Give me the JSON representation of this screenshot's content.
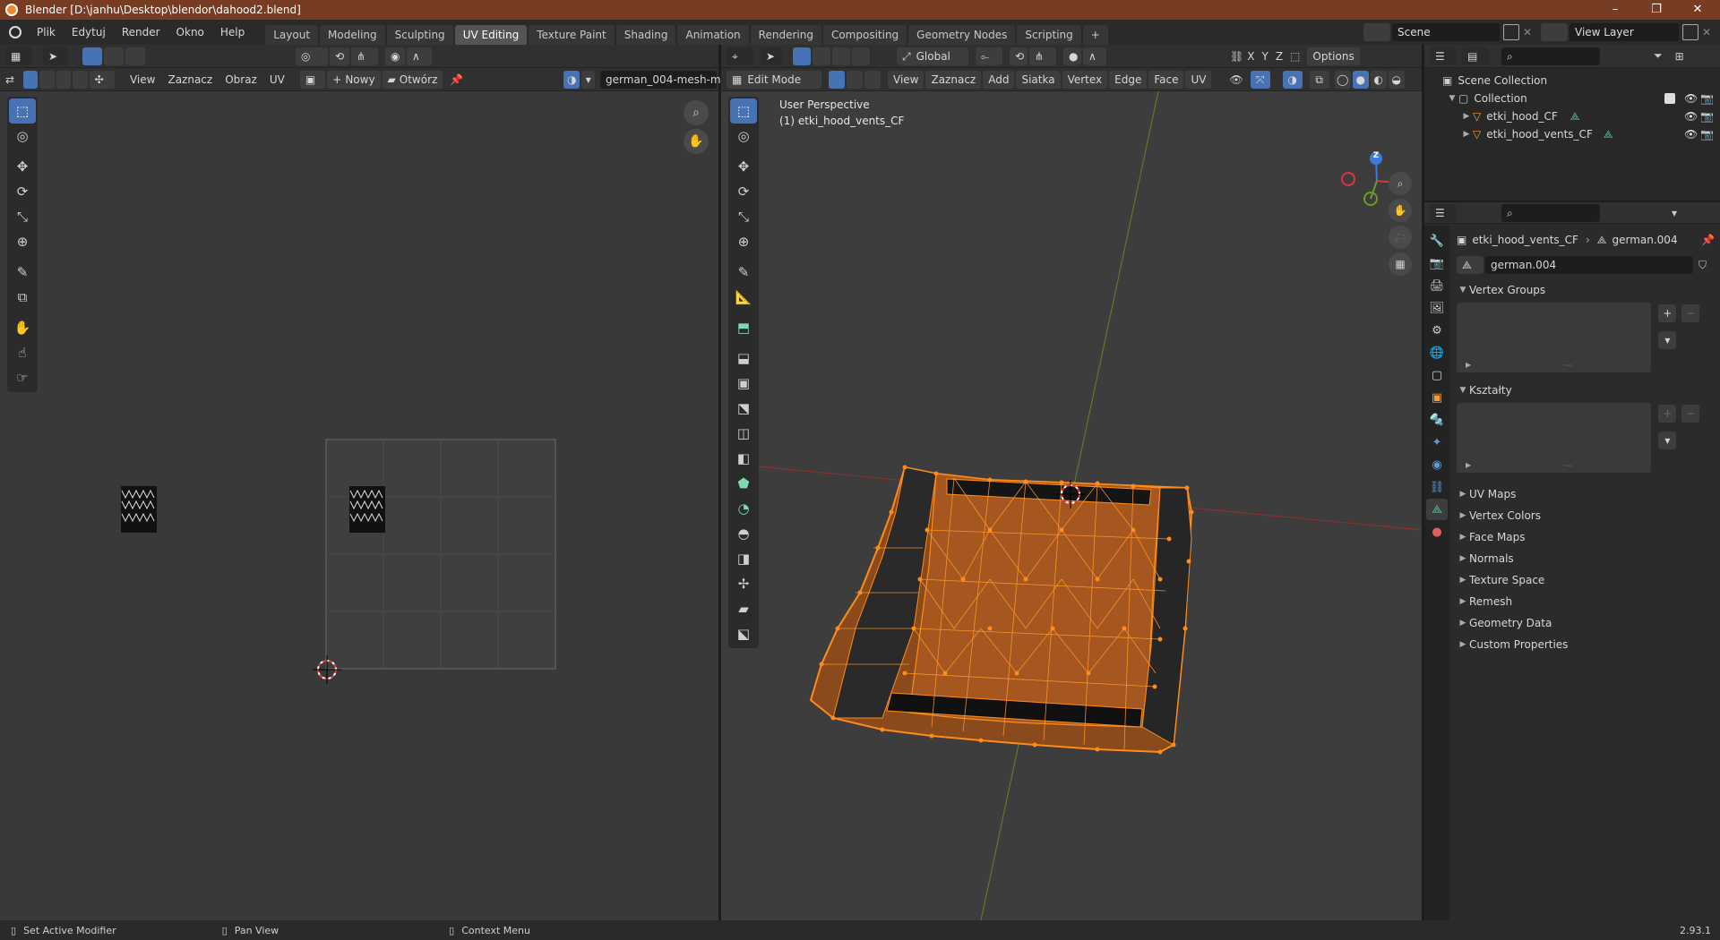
{
  "window": {
    "title": "Blender [D:\\janhu\\Desktop\\blendor\\dahood2.blend]",
    "minimize": "–",
    "restore": "❐",
    "close": "✕"
  },
  "menu": [
    "Plik",
    "Edytuj",
    "Render",
    "Okno",
    "Help"
  ],
  "workspaces": [
    {
      "label": "Layout"
    },
    {
      "label": "Modeling"
    },
    {
      "label": "Sculpting"
    },
    {
      "label": "UV Editing"
    },
    {
      "label": "Texture Paint"
    },
    {
      "label": "Shading"
    },
    {
      "label": "Animation"
    },
    {
      "label": "Rendering"
    },
    {
      "label": "Compositing"
    },
    {
      "label": "Geometry Nodes"
    },
    {
      "label": "Scripting"
    },
    {
      "label": "+"
    }
  ],
  "active_workspace": "UV Editing",
  "scene": "Scene",
  "view_layer": "View Layer",
  "uv_editor": {
    "menus": [
      "View",
      "Zaznacz",
      "Obraz",
      "UV"
    ],
    "new_label": "Nowy",
    "open_label": "Otwórz",
    "image_name": "german_004-mesh-m..."
  },
  "viewport": {
    "mode": "Edit Mode",
    "transform_orientation": "Global",
    "menus": [
      "View",
      "Zaznacz",
      "Add",
      "Siatka",
      "Vertex",
      "Edge",
      "Face",
      "UV"
    ],
    "axes": [
      "X",
      "Y",
      "Z"
    ],
    "options_label": "Options",
    "perspective": "User Perspective",
    "object_label": "(1) etki_hood_vents_CF",
    "gizmo": {
      "x": "X",
      "z": "Z"
    }
  },
  "outliner": {
    "root": "Scene Collection",
    "collection": "Collection",
    "objects": [
      "etki_hood_CF",
      "etki_hood_vents_CF"
    ]
  },
  "properties": {
    "breadcrumb_object": "etki_hood_vents_CF",
    "breadcrumb_data": "german.004",
    "datablock": "german.004",
    "panels_open": [
      "Vertex Groups",
      "Kształty"
    ],
    "panels_closed": [
      "UV Maps",
      "Vertex Colors",
      "Face Maps",
      "Normals",
      "Texture Space",
      "Remesh",
      "Geometry Data",
      "Custom Properties"
    ]
  },
  "statusbar": {
    "left": "Set Active Modifier",
    "middle": "Pan View",
    "right": "Context Menu",
    "version": "2.93.1"
  },
  "colors": {
    "accent": "#4772b3",
    "selection": "#ff8c1a",
    "titlebar": "#783c22"
  }
}
